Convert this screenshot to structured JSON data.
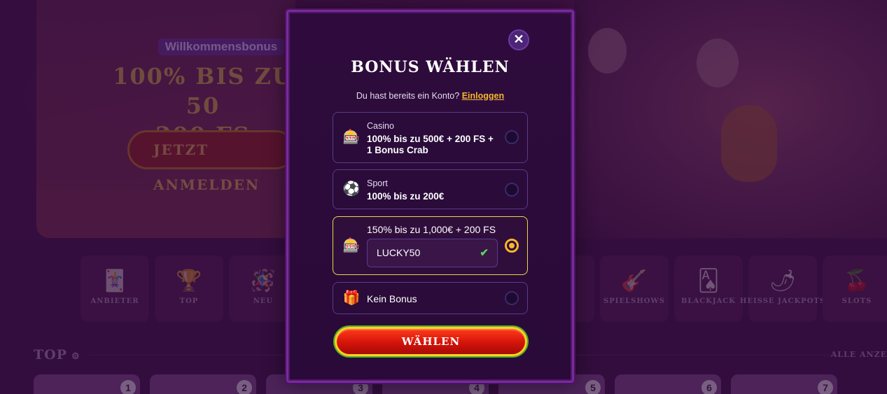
{
  "background": {
    "welcome_label": "Willkommensbonus",
    "hero_title_line1": "100% BIS ZU 50",
    "hero_title_line2": "200 FS",
    "hero_cta": "JETZT ANMELDEN",
    "categories": [
      {
        "label": "ANBIETER",
        "icon": "cards-heart-icon"
      },
      {
        "label": "TOP",
        "icon": "trophy-icon"
      },
      {
        "label": "NEU",
        "icon": "pinata-icon"
      },
      {
        "label": "",
        "icon": ""
      },
      {
        "label": "",
        "icon": ""
      },
      {
        "label": "",
        "icon": ""
      },
      {
        "label": "TTE",
        "icon": "roulette-icon"
      },
      {
        "label": "SPIELSHOWS",
        "icon": "guitar-icon"
      },
      {
        "label": "BLACKJACK",
        "icon": "playing-cards-icon"
      },
      {
        "label": "HEISSE JACKPOTS",
        "icon": "chili-icon"
      },
      {
        "label": "SLOTS",
        "icon": "cherry-icon"
      }
    ],
    "top_heading": "TOP",
    "all_link": "ALLE ANZE",
    "game_numbers": [
      "1",
      "2",
      "3",
      "4",
      "5",
      "6",
      "7"
    ]
  },
  "modal": {
    "close_icon": "close-icon",
    "title": "BONUS WÄHLEN",
    "login_prompt": "Du hast bereits ein Konto?",
    "login_link": "Einloggen",
    "options": [
      {
        "category": "Casino",
        "description": "100% bis zu 500€ + 200 FS + 1 Bonus Crab",
        "icon": "slot-machine-icon",
        "selected": false
      },
      {
        "category": "Sport",
        "description": "100% bis zu 200€",
        "icon": "soccer-ball-icon",
        "selected": false
      },
      {
        "category": "",
        "description": "150% bis zu 1,000€ + 200 FS",
        "icon": "slot-machine-gold-icon",
        "selected": true,
        "code": "LUCKY50"
      },
      {
        "category": "",
        "description": "Kein Bonus",
        "icon": "gift-crossed-icon",
        "selected": false
      }
    ],
    "submit_label": "WÄHLEN"
  },
  "colors": {
    "accent_gold": "#f5b72a",
    "selected_border": "#e6d84a",
    "button_red": "#d4140a",
    "check_green": "#5bd35b"
  }
}
